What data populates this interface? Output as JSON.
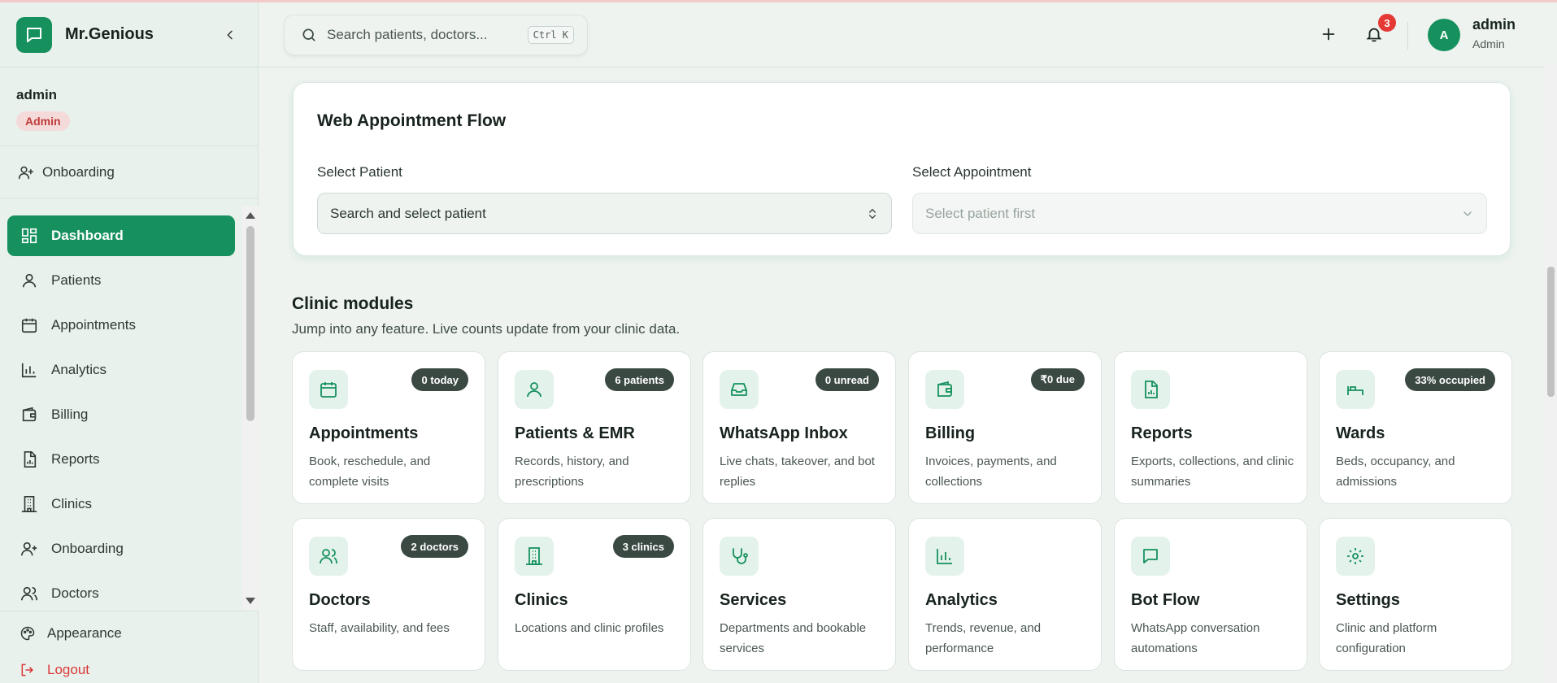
{
  "brand": {
    "name": "Mr.Genious"
  },
  "user": {
    "name": "admin",
    "role": "Admin"
  },
  "sidebar": {
    "onboarding_top": "Onboarding",
    "items": [
      {
        "label": "Dashboard",
        "icon": "dashboard-icon",
        "active": true
      },
      {
        "label": "Patients",
        "icon": "user-icon"
      },
      {
        "label": "Appointments",
        "icon": "calendar-icon"
      },
      {
        "label": "Analytics",
        "icon": "bar-chart-icon"
      },
      {
        "label": "Billing",
        "icon": "wallet-icon"
      },
      {
        "label": "Reports",
        "icon": "report-icon"
      },
      {
        "label": "Clinics",
        "icon": "building-icon"
      },
      {
        "label": "Onboarding",
        "icon": "user-plus-icon"
      },
      {
        "label": "Doctors",
        "icon": "users-icon"
      }
    ],
    "appearance": "Appearance",
    "logout": "Logout"
  },
  "header": {
    "search_placeholder": "Search patients, doctors...",
    "shortcut": "Ctrl K",
    "notification_count": "3",
    "avatar_initial": "A",
    "user_name": "admin",
    "user_role": "Admin"
  },
  "flow": {
    "title": "Web Appointment Flow",
    "patient_label": "Select Patient",
    "patient_placeholder": "Search and select patient",
    "appointment_label": "Select Appointment",
    "appointment_placeholder": "Select patient first"
  },
  "modules": {
    "title": "Clinic modules",
    "subtitle": "Jump into any feature. Live counts update from your clinic data.",
    "items": [
      {
        "name": "Appointments",
        "badge": "0 today",
        "desc": "Book, reschedule, and complete visits",
        "icon": "calendar-icon"
      },
      {
        "name": "Patients & EMR",
        "badge": "6 patients",
        "desc": "Records, history, and prescriptions",
        "icon": "user-icon"
      },
      {
        "name": "WhatsApp Inbox",
        "badge": "0 unread",
        "desc": "Live chats, takeover, and bot replies",
        "icon": "inbox-icon"
      },
      {
        "name": "Billing",
        "badge": "₹0 due",
        "desc": "Invoices, payments, and collections",
        "icon": "wallet-icon"
      },
      {
        "name": "Reports",
        "badge": "",
        "desc": "Exports, collections, and clinic summaries",
        "icon": "report-icon"
      },
      {
        "name": "Wards",
        "badge": "33% occupied",
        "desc": "Beds, occupancy, and admissions",
        "icon": "bed-icon"
      },
      {
        "name": "Doctors",
        "badge": "2 doctors",
        "desc": "Staff, availability, and fees",
        "icon": "users-icon"
      },
      {
        "name": "Clinics",
        "badge": "3 clinics",
        "desc": "Locations and clinic profiles",
        "icon": "building-icon"
      },
      {
        "name": "Services",
        "badge": "",
        "desc": "Departments and bookable services",
        "icon": "stethoscope-icon"
      },
      {
        "name": "Analytics",
        "badge": "",
        "desc": "Trends, revenue, and performance",
        "icon": "bar-chart-icon"
      },
      {
        "name": "Bot Flow",
        "badge": "",
        "desc": "WhatsApp conversation automations",
        "icon": "message-icon"
      },
      {
        "name": "Settings",
        "badge": "",
        "desc": "Clinic and platform configuration",
        "icon": "gear-icon"
      }
    ]
  },
  "colors": {
    "accent": "#16915e",
    "badge": "#3b4943",
    "danger": "#e53935"
  }
}
